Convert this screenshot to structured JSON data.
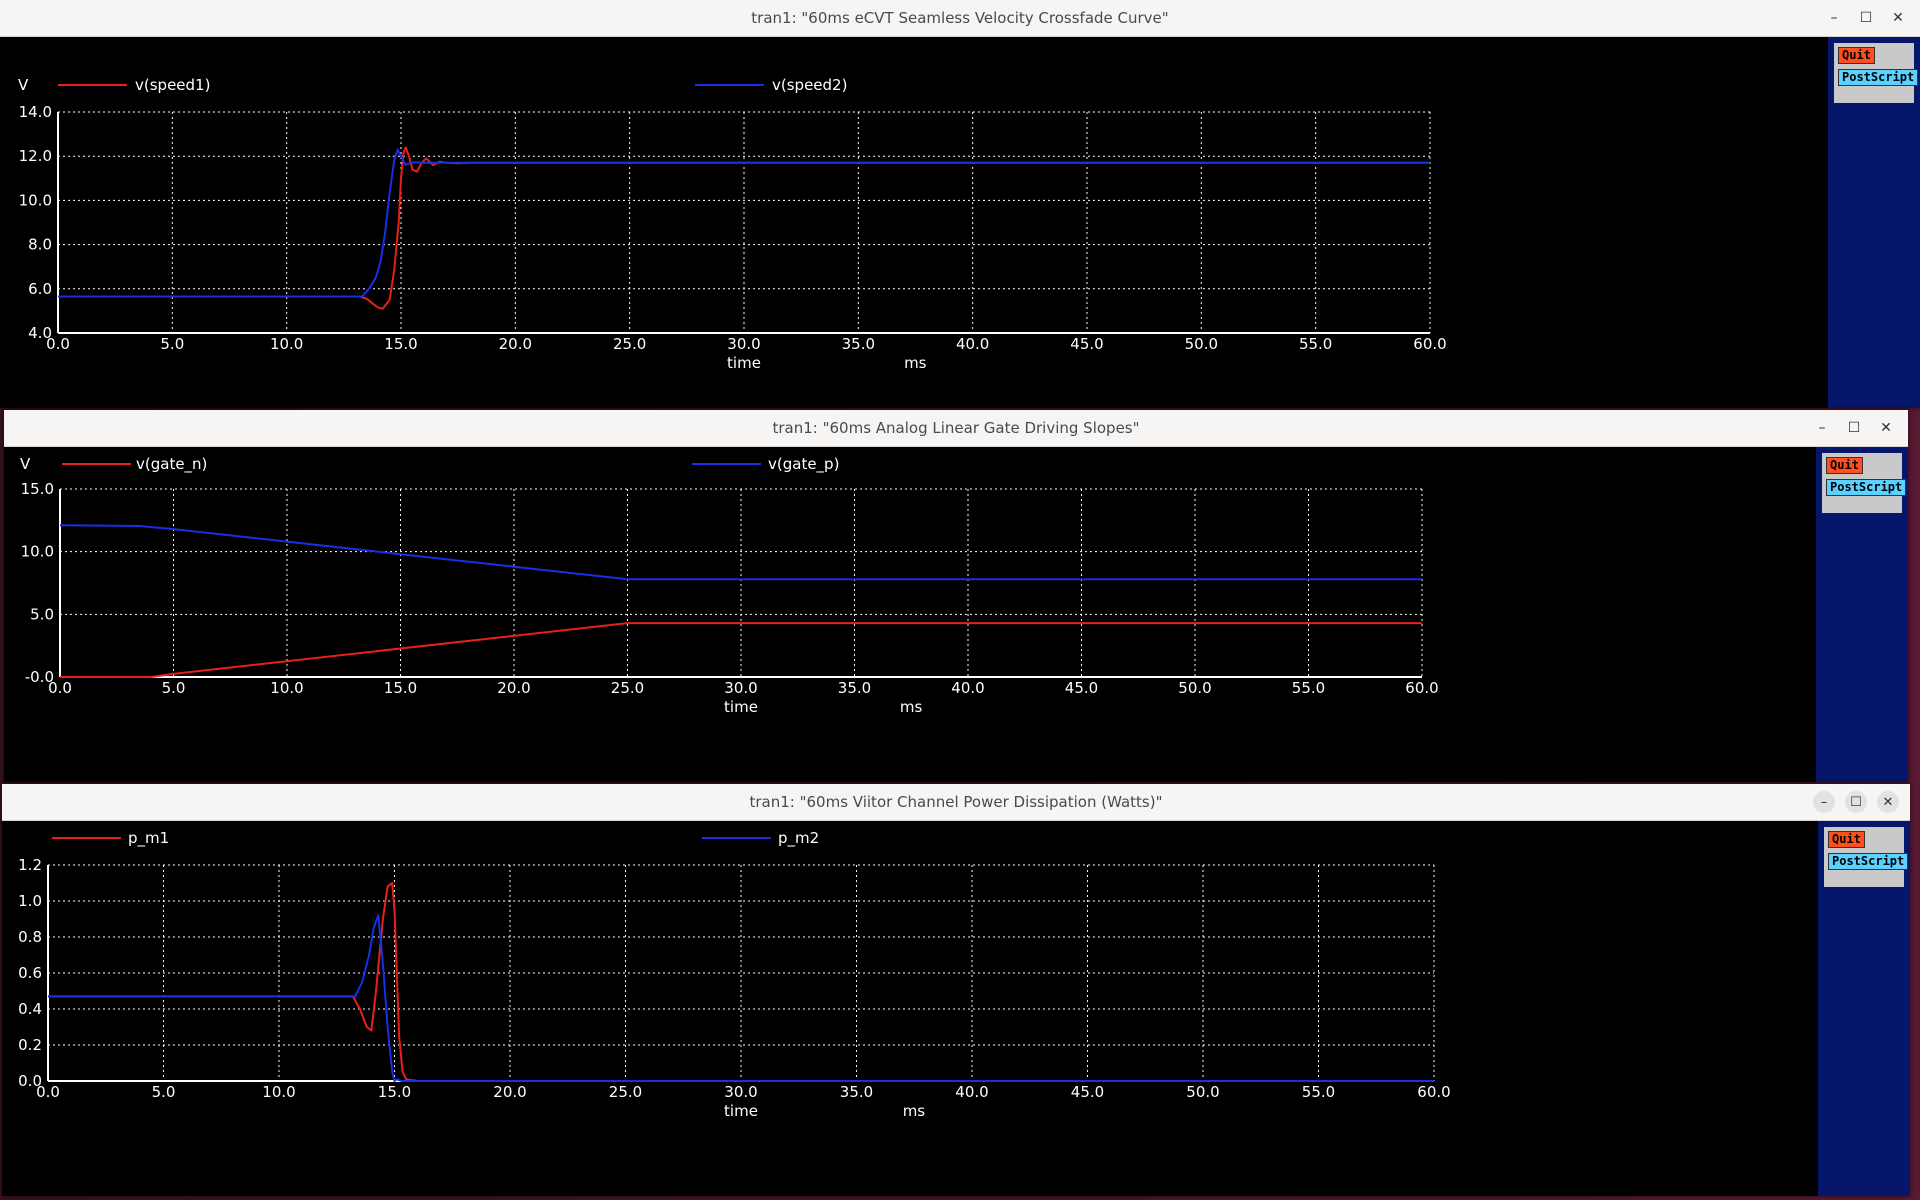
{
  "windows": [
    {
      "title": "tran1: \"60ms eCVT Seamless Velocity Crossfade Curve\"",
      "yunit": "V",
      "xlabel": "time",
      "xunit": "ms",
      "quit_label": "Quit",
      "postscript_label": "PostScript",
      "legend": [
        {
          "name": "v(speed1)",
          "color": "#e8201a"
        },
        {
          "name": "v(speed2)",
          "color": "#1a2ee8"
        }
      ],
      "yticks": [
        "4.0",
        "6.0",
        "8.0",
        "10.0",
        "12.0",
        "14.0"
      ],
      "xticks": [
        "0.0",
        "5.0",
        "10.0",
        "15.0",
        "20.0",
        "25.0",
        "30.0",
        "35.0",
        "40.0",
        "45.0",
        "50.0",
        "55.0",
        "60.0"
      ]
    },
    {
      "title": "tran1: \"60ms Analog Linear Gate Driving Slopes\"",
      "yunit": "V",
      "xlabel": "time",
      "xunit": "ms",
      "quit_label": "Quit",
      "postscript_label": "PostScript",
      "legend": [
        {
          "name": "v(gate_n)",
          "color": "#e8201a"
        },
        {
          "name": "v(gate_p)",
          "color": "#1a2ee8"
        }
      ],
      "yticks": [
        "-0.0",
        "5.0",
        "10.0",
        "15.0"
      ],
      "xticks": [
        "0.0",
        "5.0",
        "10.0",
        "15.0",
        "20.0",
        "25.0",
        "30.0",
        "35.0",
        "40.0",
        "45.0",
        "50.0",
        "55.0",
        "60.0"
      ]
    },
    {
      "title": "tran1: \"60ms Viitor Channel Power Dissipation (Watts)\"",
      "yunit": "",
      "xlabel": "time",
      "xunit": "ms",
      "quit_label": "Quit",
      "postscript_label": "PostScript",
      "legend": [
        {
          "name": "p_m1",
          "color": "#e8201a"
        },
        {
          "name": "p_m2",
          "color": "#1a2ee8"
        }
      ],
      "yticks": [
        "0.0",
        "0.2",
        "0.4",
        "0.6",
        "0.8",
        "1.0",
        "1.2"
      ],
      "xticks": [
        "0.0",
        "5.0",
        "10.0",
        "15.0",
        "20.0",
        "25.0",
        "30.0",
        "35.0",
        "40.0",
        "45.0",
        "50.0",
        "55.0",
        "60.0"
      ]
    }
  ],
  "chart_data": [
    {
      "type": "line",
      "title": "tran1: \"60ms eCVT Seamless Velocity Crossfade Curve\"",
      "xlabel": "time",
      "ylabel": "V",
      "xlim": [
        0,
        60
      ],
      "ylim": [
        4,
        14
      ],
      "grid": true,
      "legend": "top",
      "series": [
        {
          "name": "v(speed1)",
          "x": [
            0,
            13.2,
            13.5,
            13.8,
            14.0,
            14.2,
            14.5,
            14.7,
            14.9,
            15.0,
            15.1,
            15.2,
            15.35,
            15.5,
            15.7,
            15.9,
            16.1,
            16.4,
            16.7,
            17.0,
            17.5,
            18.0,
            60
          ],
          "y": [
            5.65,
            5.65,
            5.55,
            5.3,
            5.15,
            5.1,
            5.5,
            6.8,
            9.0,
            11.0,
            12.1,
            12.4,
            12.0,
            11.4,
            11.3,
            11.7,
            11.9,
            11.6,
            11.75,
            11.7,
            11.68,
            11.7,
            11.7
          ]
        },
        {
          "name": "v(speed2)",
          "x": [
            0,
            13.3,
            13.6,
            13.9,
            14.1,
            14.3,
            14.5,
            14.7,
            14.85,
            15.0,
            15.2,
            15.4,
            15.7,
            16.0,
            60
          ],
          "y": [
            5.65,
            5.65,
            6.0,
            6.5,
            7.2,
            8.5,
            10.3,
            11.8,
            12.3,
            12.0,
            11.6,
            11.7,
            11.72,
            11.7,
            11.7
          ]
        }
      ]
    },
    {
      "type": "line",
      "title": "tran1: \"60ms Analog Linear Gate Driving Slopes\"",
      "xlabel": "time",
      "ylabel": "V",
      "xlim": [
        0,
        60
      ],
      "ylim": [
        0,
        15
      ],
      "grid": true,
      "legend": "top",
      "series": [
        {
          "name": "v(gate_n)",
          "x": [
            0,
            4.0,
            5.0,
            25.0,
            60
          ],
          "y": [
            0,
            0,
            0.25,
            4.3,
            4.3
          ]
        },
        {
          "name": "v(gate_p)",
          "x": [
            0,
            3.5,
            5.0,
            10.0,
            15.0,
            20.0,
            25.0,
            60
          ],
          "y": [
            12.1,
            12.05,
            11.8,
            10.8,
            9.8,
            8.8,
            7.8,
            7.8
          ]
        }
      ]
    },
    {
      "type": "line",
      "title": "tran1: \"60ms Viitor Channel Power Dissipation (Watts)\"",
      "xlabel": "time",
      "ylabel": "",
      "xlim": [
        0,
        60
      ],
      "ylim": [
        0,
        1.2
      ],
      "grid": true,
      "legend": "top",
      "series": [
        {
          "name": "p_m1",
          "x": [
            0,
            13.2,
            13.5,
            13.8,
            14.0,
            14.2,
            14.5,
            14.7,
            14.9,
            15.0,
            15.1,
            15.2,
            15.35,
            15.5,
            16.0,
            60
          ],
          "y": [
            0.47,
            0.47,
            0.4,
            0.3,
            0.28,
            0.5,
            0.9,
            1.08,
            1.1,
            0.95,
            0.6,
            0.25,
            0.05,
            0.01,
            0.0,
            0.0
          ]
        },
        {
          "name": "p_m2",
          "x": [
            0,
            13.3,
            13.6,
            13.9,
            14.1,
            14.3,
            14.5,
            14.7,
            14.9,
            15.0,
            15.1,
            15.3,
            15.5,
            60
          ],
          "y": [
            0.47,
            0.47,
            0.55,
            0.7,
            0.85,
            0.92,
            0.65,
            0.3,
            0.05,
            0.0,
            0.01,
            0.0,
            0.0,
            0.0
          ]
        }
      ]
    }
  ]
}
